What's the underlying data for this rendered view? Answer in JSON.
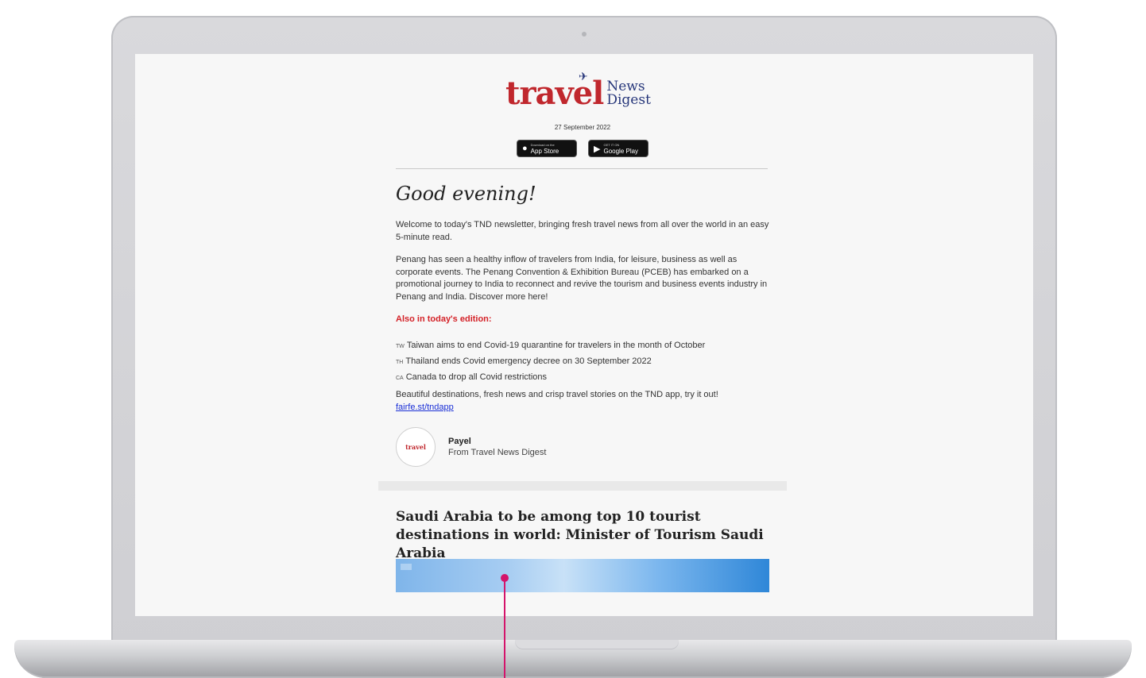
{
  "newsletter": {
    "logo": {
      "travel": "travel",
      "news": "News",
      "digest": "Digest"
    },
    "date": "27 September 2022",
    "badges": {
      "app_store": {
        "small": "Download on the",
        "label": "App Store"
      },
      "google_play": {
        "small": "GET IT ON",
        "label": "Google Play"
      }
    },
    "greeting": "Good evening!",
    "intro": "Welcome to today's TND newsletter, bringing fresh travel news from all over the world in an easy 5-minute read.",
    "story": "Penang has seen a healthy inflow of travelers from India, for leisure, business as well as corporate events. The Penang Convention & Exhibition Bureau (PCEB) has embarked on a promotional journey to India to reconnect and revive the tourism and business events industry in Penang and India. Discover more here!",
    "also_heading": "Also in today's edition:",
    "highlights": [
      {
        "code": "TW",
        "text": "Taiwan aims to end Covid-19 quarantine for travelers in the month of October"
      },
      {
        "code": "TH",
        "text": "Thailand ends Covid emergency decree on 30 September 2022"
      },
      {
        "code": "CA",
        "text": "Canada to drop all Covid restrictions"
      }
    ],
    "app_promo": "Beautiful destinations, fresh news and crisp travel stories on the TND app, try it out!",
    "app_link": "fairfe.st/tndapp",
    "author": {
      "avatar_text": "travel",
      "name": "Payel",
      "org": "From Travel News Digest"
    },
    "article_title": "Saudi Arabia to be among top 10 tourist destinations in world: Minister of Tourism Saudi Arabia"
  },
  "colors": {
    "brand_red": "#c0272d",
    "brand_blue": "#26367a",
    "link": "#1a2fd6",
    "pointer": "#d4146b"
  }
}
